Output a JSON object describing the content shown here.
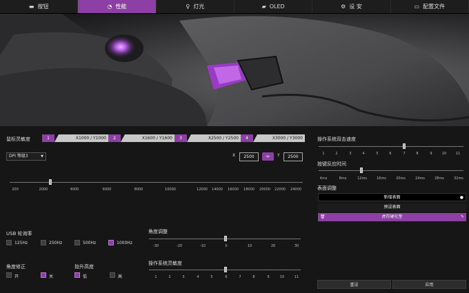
{
  "tabs": [
    {
      "label": "按钮",
      "icon": "keyboard-icon",
      "active": false
    },
    {
      "label": "性能",
      "icon": "gauge-icon",
      "active": true
    },
    {
      "label": "灯光",
      "icon": "bulb-icon",
      "active": false
    },
    {
      "label": "OLED",
      "icon": "oled-icon",
      "active": false
    },
    {
      "label": "设 安",
      "icon": "settings-icon",
      "active": false
    },
    {
      "label": "配置文件",
      "icon": "folder-icon",
      "active": false
    }
  ],
  "dpi": {
    "label": "鼠标灵敏度",
    "stages": [
      {
        "num": "1",
        "value": "X1000 / Y1000"
      },
      {
        "num": "2",
        "value": "X1600 / Y1600"
      },
      {
        "num": "3",
        "value": "X2500 / Y2500"
      },
      {
        "num": "4",
        "value": "X3000 / Y3000"
      }
    ],
    "select_value": "DPI 等级3",
    "x_label": "X",
    "x_value": "2500",
    "y_label": "Y",
    "y_value": "2500",
    "scale_ticks": [
      "200",
      "2000",
      "4000",
      "6000",
      "8000",
      "10000",
      "12000",
      "14000",
      "16000",
      "18000",
      "20000",
      "22000",
      "24000"
    ]
  },
  "usb": {
    "label": "USB 轮询率",
    "options": [
      {
        "label": "125Hz",
        "checked": false
      },
      {
        "label": "250Hz",
        "checked": false
      },
      {
        "label": "500Hz",
        "checked": false
      },
      {
        "label": "1000Hz",
        "checked": true
      }
    ]
  },
  "angle_correction": {
    "label": "角度修正",
    "options": [
      {
        "label": "开",
        "checked": false
      },
      {
        "label": "关",
        "checked": true
      }
    ]
  },
  "lift_height": {
    "label": "抬升高度",
    "options": [
      {
        "label": "低",
        "checked": true
      },
      {
        "label": "高",
        "checked": false
      }
    ]
  },
  "angle_tuning": {
    "label": "角度调整",
    "ticks": [
      "-30",
      "-20",
      "-10",
      "0",
      "10",
      "20",
      "30"
    ],
    "value": 0
  },
  "os_sensitivity": {
    "label": "操作系统灵敏度",
    "ticks": [
      "1",
      "2",
      "3",
      "4",
      "5",
      "6",
      "7",
      "8",
      "9",
      "10",
      "11"
    ],
    "value": 6
  },
  "double_click": {
    "label": "操作系统双击速度",
    "ticks": [
      "1",
      "2",
      "3",
      "4",
      "5",
      "6",
      "7",
      "8",
      "9",
      "10",
      "11"
    ],
    "value": 7
  },
  "debounce": {
    "label": "按键反应时间",
    "ticks": [
      "4ms",
      "8ms",
      "12ms",
      "16ms",
      "20ms",
      "24ms",
      "28ms",
      "32ms"
    ],
    "value": "12ms"
  },
  "surface": {
    "label": "表面调整",
    "add_label": "新增表面",
    "preset_label": "预设表面",
    "selected_label": "虎符硬化垫"
  },
  "footer": {
    "reset_label": "重设",
    "apply_label": "应用"
  },
  "colors": {
    "accent": "#8e3fa6"
  }
}
